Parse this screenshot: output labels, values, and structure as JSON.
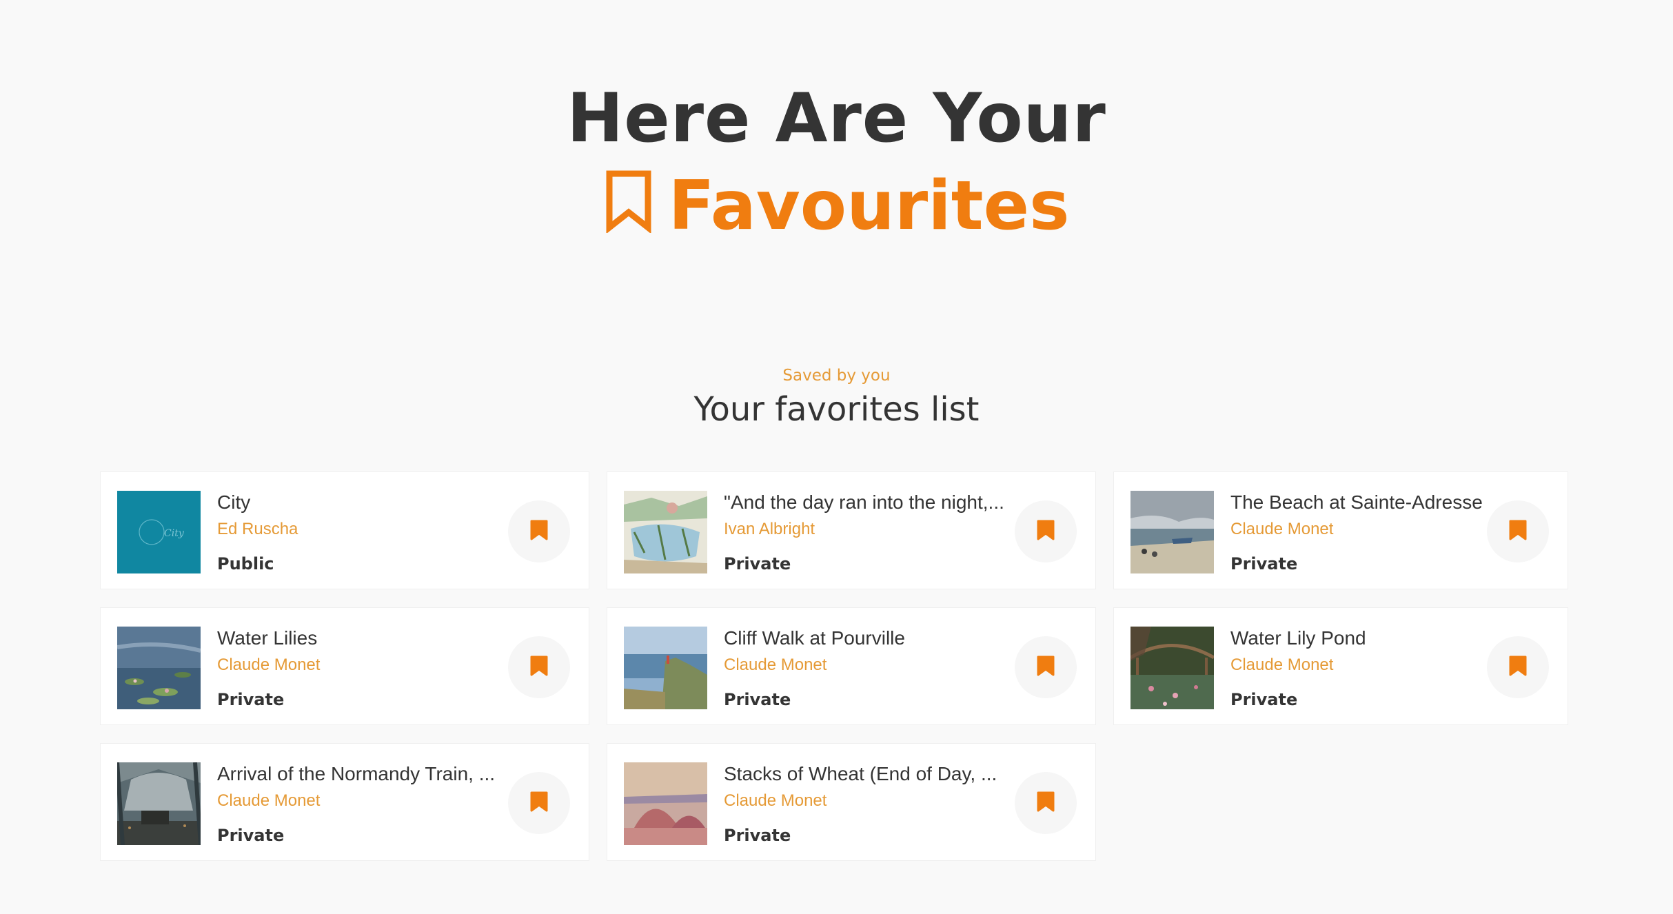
{
  "hero": {
    "line1": "Here Are Your",
    "line2": "Favourites",
    "accent_color": "#f07d10",
    "icon": "bookmark-outline-icon"
  },
  "section": {
    "eyebrow": "Saved by you",
    "title": "Your favorites list"
  },
  "favorites": [
    {
      "title": "City",
      "artist": "Ed Ruscha",
      "visibility": "Public",
      "thumb": "teal-abstract"
    },
    {
      "title": "\"And the day ran into the night,...",
      "artist": "Ivan Albright",
      "visibility": "Private",
      "thumb": "sketch-landscape"
    },
    {
      "title": "The Beach at Sainte-Adresse",
      "artist": "Claude Monet",
      "visibility": "Private",
      "thumb": "beach"
    },
    {
      "title": "Water Lilies",
      "artist": "Claude Monet",
      "visibility": "Private",
      "thumb": "water-lilies"
    },
    {
      "title": "Cliff Walk at Pourville",
      "artist": "Claude Monet",
      "visibility": "Private",
      "thumb": "cliff"
    },
    {
      "title": "Water Lily Pond",
      "artist": "Claude Monet",
      "visibility": "Private",
      "thumb": "lily-pond"
    },
    {
      "title": "Arrival of the Normandy Train, ...",
      "artist": "Claude Monet",
      "visibility": "Private",
      "thumb": "train"
    },
    {
      "title": "Stacks of Wheat (End of Day, ...",
      "artist": "Claude Monet",
      "visibility": "Private",
      "thumb": "wheat"
    }
  ],
  "save_button_icon": "bookmark-filled-icon"
}
